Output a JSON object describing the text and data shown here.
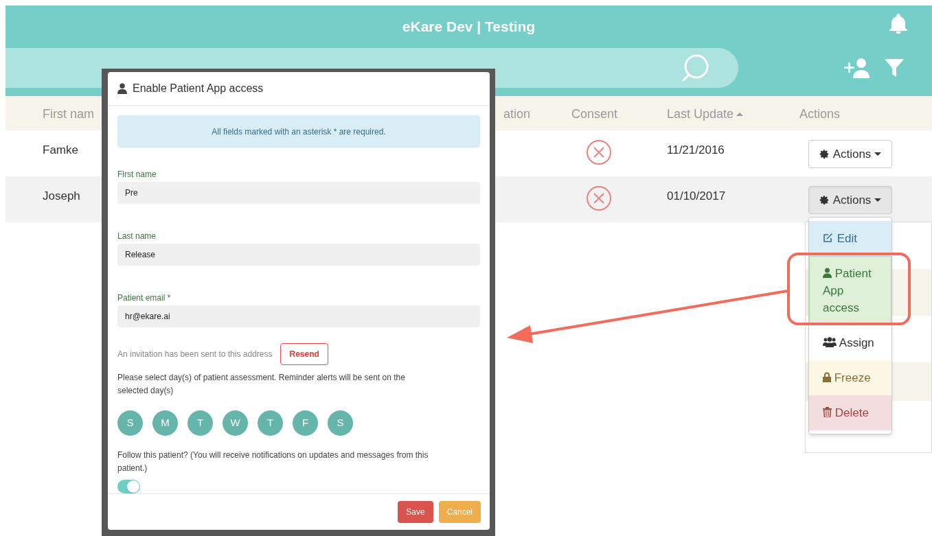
{
  "app_title": "eKare Dev | Testing",
  "table": {
    "columns": [
      {
        "label": "First nam"
      },
      {
        "label": "ation"
      },
      {
        "label": "Consent"
      },
      {
        "label": "Last Update",
        "sorted": true
      },
      {
        "label": "Actions"
      }
    ],
    "rows": [
      {
        "first_name": "Famke",
        "consent": false,
        "last_update": "11/21/2016",
        "actions": "Actions",
        "open": false
      },
      {
        "first_name": "Joseph",
        "consent": false,
        "last_update": "01/10/2017",
        "actions": "Actions",
        "open": true
      }
    ]
  },
  "action_menu": [
    {
      "kind": "edit",
      "label": "Edit",
      "highlighted": false
    },
    {
      "kind": "patient",
      "label": "Patient App access",
      "highlighted": true
    },
    {
      "kind": "assign",
      "label": "Assign",
      "highlighted": false
    },
    {
      "kind": "freeze",
      "label": "Freeze",
      "highlighted": false
    },
    {
      "kind": "delete",
      "label": "Delete",
      "highlighted": false
    }
  ],
  "modal": {
    "title": "Enable Patient App access",
    "notice": "All fields marked with an asterisk * are required.",
    "fields": [
      {
        "label": "First name",
        "value": "Pre"
      },
      {
        "label": "Last name",
        "value": "Release"
      },
      {
        "label": "Patient email *",
        "value": "hr@ekare.ai"
      }
    ],
    "invitation_text": "An invitation has been sent to this address",
    "resend": "Resend",
    "days_prompt": "Please select day(s) of patient assessment. Reminder alerts will be sent on the selected day(s)",
    "days": [
      {
        "label": "S"
      },
      {
        "label": "M"
      },
      {
        "label": "T"
      },
      {
        "label": "W"
      },
      {
        "label": "T"
      },
      {
        "label": "F"
      },
      {
        "label": "S"
      }
    ],
    "follow_prompt": "Follow this patient? (You will receive notifications on updates and messages from this patient.)",
    "follow": {
      "on": true
    },
    "buttons": [
      {
        "kind": "save",
        "label": "Save"
      },
      {
        "kind": "cancel",
        "label": "Cancel"
      }
    ]
  }
}
